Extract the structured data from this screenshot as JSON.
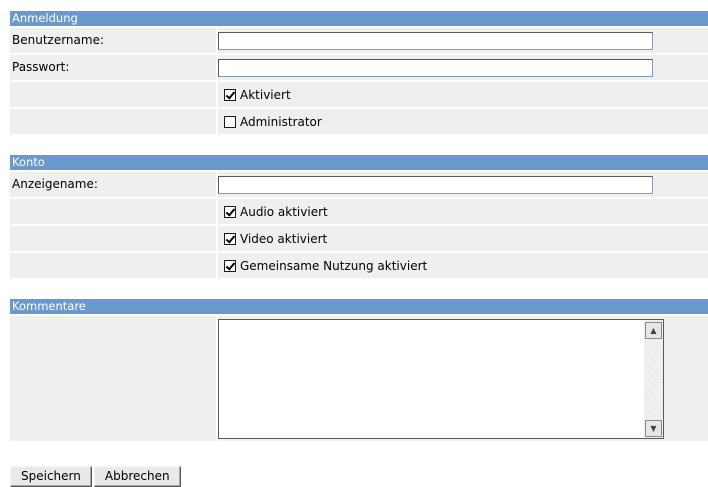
{
  "sections": {
    "login": {
      "header": "Anmeldung",
      "username_label": "Benutzername:",
      "username_value": "",
      "password_label": "Passwort:",
      "password_value": "",
      "activated_label": "Aktiviert",
      "activated_checked": true,
      "admin_label": "Administrator",
      "admin_checked": false
    },
    "account": {
      "header": "Konto",
      "display_name_label": "Anzeigename:",
      "display_name_value": "",
      "audio_label": "Audio aktiviert",
      "audio_checked": true,
      "video_label": "Video aktiviert",
      "video_checked": true,
      "sharing_label": "Gemeinsame Nutzung aktiviert",
      "sharing_checked": true
    },
    "comments": {
      "header": "Kommentare",
      "value": ""
    }
  },
  "buttons": {
    "save": "Speichern",
    "cancel": "Abbrechen"
  },
  "icons": {
    "scroll_up": "arrow-up",
    "scroll_down": "arrow-down"
  }
}
